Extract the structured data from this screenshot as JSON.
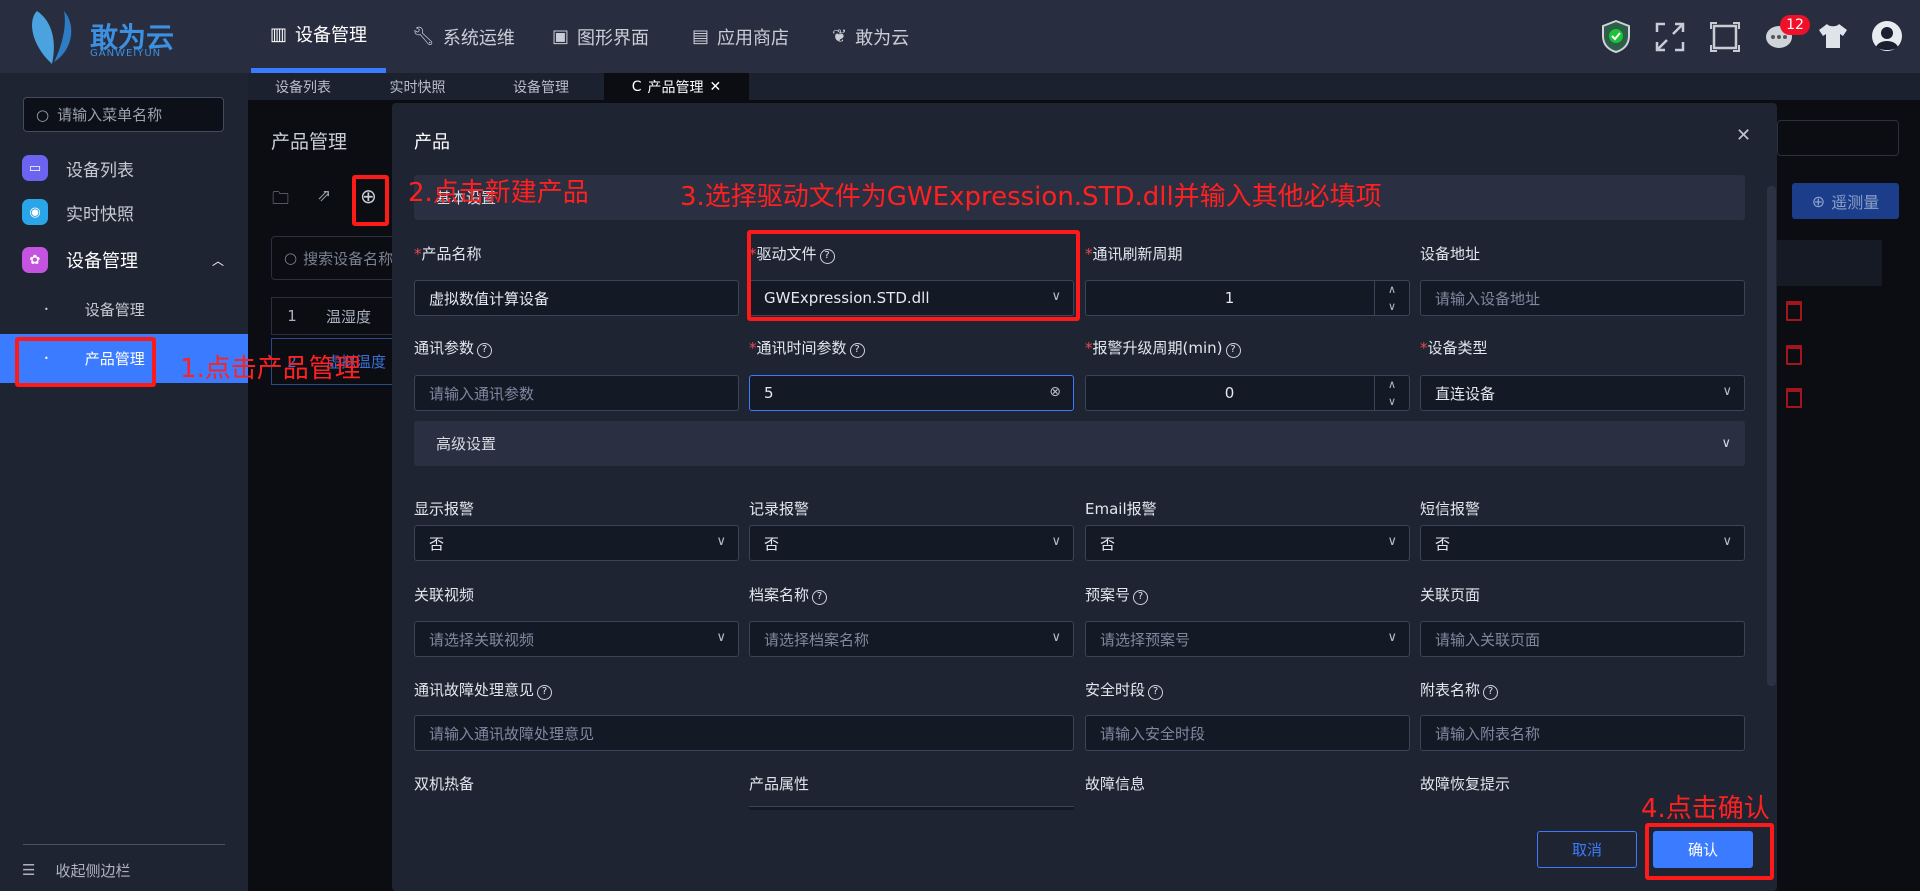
{
  "header": {
    "logo_text": "敢为云",
    "logo_sub": "GANWEIYUN",
    "nav": [
      {
        "label": "设备管理",
        "icon": "device-bars-icon"
      },
      {
        "label": "系统运维",
        "icon": "wrench-icon"
      },
      {
        "label": "图形界面",
        "icon": "monitor-icon"
      },
      {
        "label": "应用商店",
        "icon": "store-icon"
      },
      {
        "label": "敢为云",
        "icon": "butterfly-icon"
      }
    ],
    "notification_count": "12"
  },
  "tabs": [
    {
      "label": "设备列表"
    },
    {
      "label": "实时快照"
    },
    {
      "label": "设备管理"
    },
    {
      "label": "产品管理",
      "refresh": "C",
      "close": "✕"
    }
  ],
  "sidebar": {
    "search_placeholder": "请输入菜单名称",
    "items": [
      {
        "label": "设备列表",
        "color": "#6c63f0"
      },
      {
        "label": "实时快照",
        "color": "#2aa6e8"
      },
      {
        "label": "设备管理",
        "color": "#c454e0"
      }
    ],
    "sub_items": [
      {
        "label": "设备管理"
      },
      {
        "label": "产品管理"
      }
    ],
    "collapse_label": "收起侧边栏"
  },
  "page": {
    "title": "产品管理",
    "search_placeholder": "搜索设备名称",
    "telemetry_button": "遥测量",
    "rows": [
      {
        "index": "1",
        "name": "温湿度"
      },
      {
        "index": "2",
        "name": "虚拟温度"
      }
    ]
  },
  "modal": {
    "title": "产品",
    "basic_section": "基本设置",
    "advanced_section": "高级设置",
    "fields": {
      "product_name": {
        "label": "产品名称",
        "value": "虚拟数值计算设备"
      },
      "driver_file": {
        "label": "驱动文件",
        "value": "GWExpression.STD.dll"
      },
      "refresh_period": {
        "label": "通讯刷新周期",
        "value": "1"
      },
      "device_address": {
        "label": "设备地址",
        "placeholder": "请输入设备地址"
      },
      "comm_params": {
        "label": "通讯参数",
        "placeholder": "请输入通讯参数"
      },
      "comm_time_params": {
        "label": "通讯时间参数",
        "value": "5"
      },
      "alarm_upgrade": {
        "label": "报警升级周期(min)",
        "value": "0"
      },
      "device_type": {
        "label": "设备类型",
        "value": "直连设备"
      },
      "show_alarm": {
        "label": "显示报警",
        "value": "否"
      },
      "record_alarm": {
        "label": "记录报警",
        "value": "否"
      },
      "email_alarm": {
        "label": "Email报警",
        "value": "否"
      },
      "sms_alarm": {
        "label": "短信报警",
        "value": "否"
      },
      "video": {
        "label": "关联视频",
        "placeholder": "请选择关联视频"
      },
      "archive": {
        "label": "档案名称",
        "placeholder": "请选择档案名称"
      },
      "plan": {
        "label": "预案号",
        "placeholder": "请选择预案号"
      },
      "page": {
        "label": "关联页面",
        "placeholder": "请输入关联页面"
      },
      "fault_opinion": {
        "label": "通讯故障处理意见",
        "placeholder": "请输入通讯故障处理意见"
      },
      "safe_time": {
        "label": "安全时段",
        "placeholder": "请输入安全时段"
      },
      "attach_table": {
        "label": "附表名称",
        "placeholder": "请输入附表名称"
      },
      "hot_standby": {
        "label": "双机热备"
      },
      "product_attr": {
        "label": "产品属性"
      },
      "fault_info": {
        "label": "故障信息"
      },
      "recovery_tip": {
        "label": "故障恢复提示"
      }
    },
    "cancel": "取消",
    "confirm": "确认"
  },
  "annotations": {
    "step1": "1.点击产品管理",
    "step2": "2.点击新建产品",
    "step3": "3.选择驱动文件为GWExpression.STD.dll并输入其他必填项",
    "step4": "4.点击确认"
  }
}
